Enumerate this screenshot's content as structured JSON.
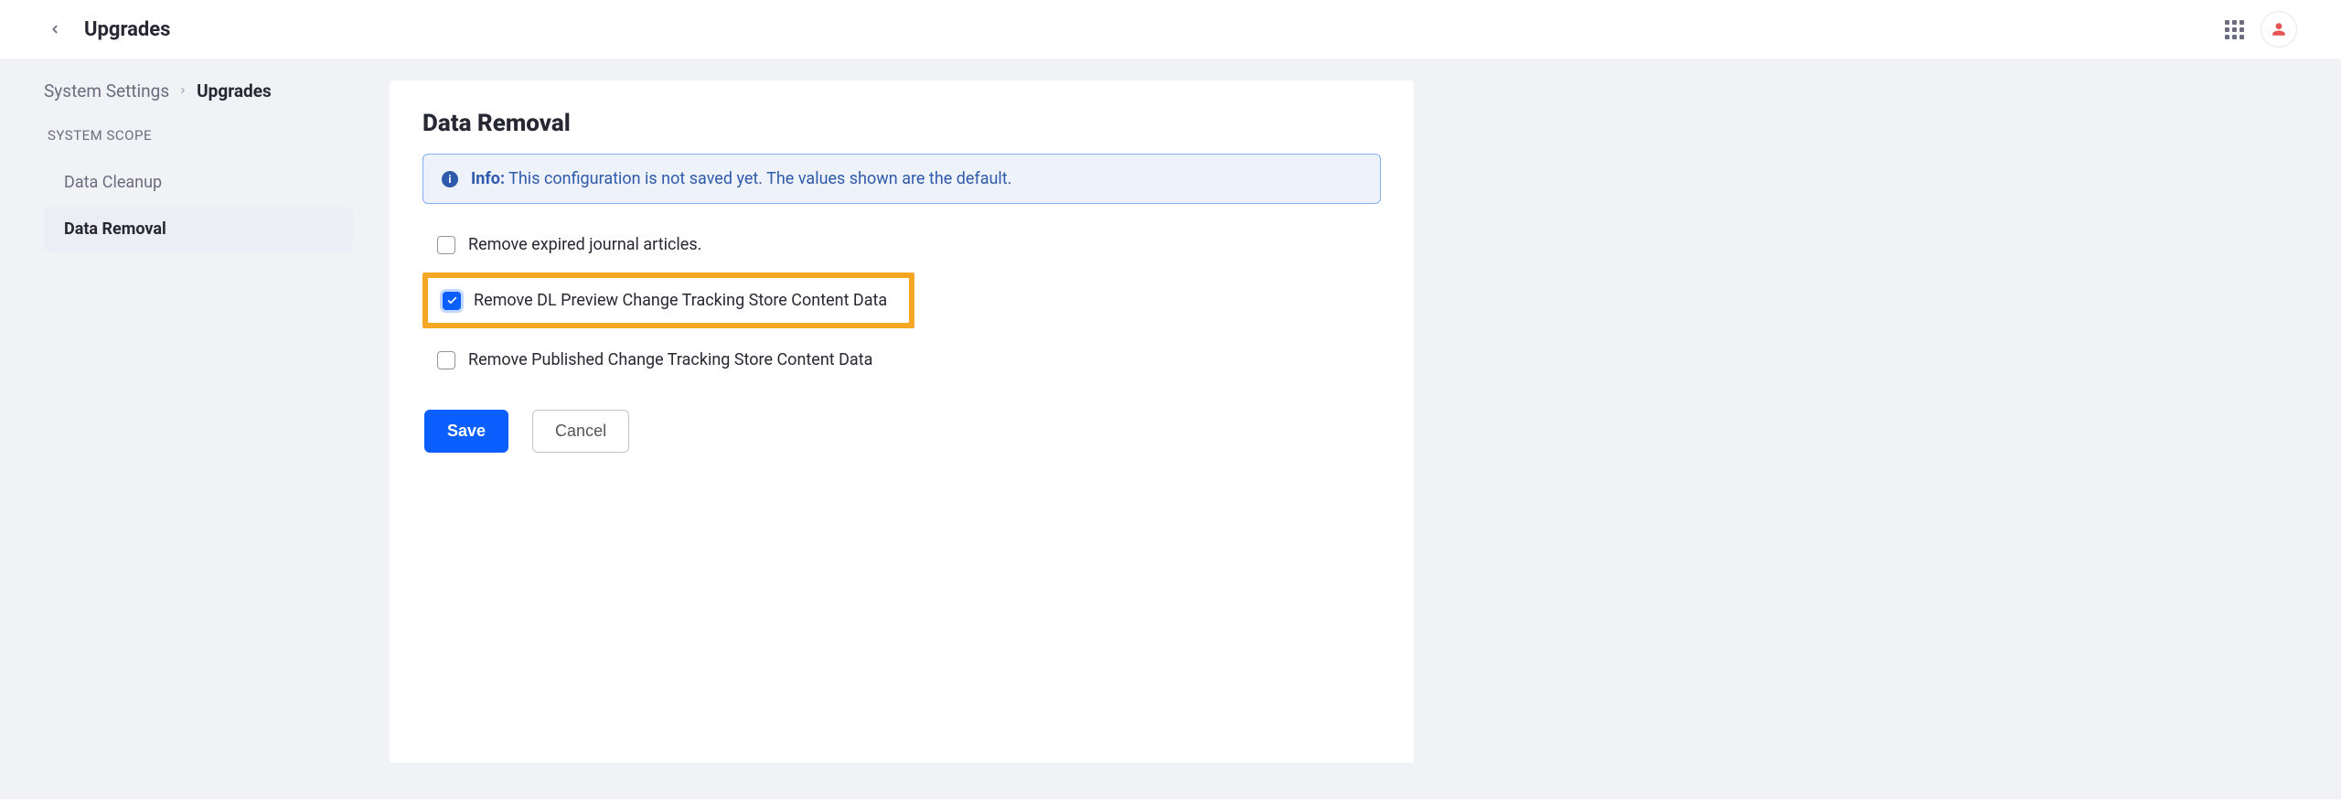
{
  "topbar": {
    "title": "Upgrades"
  },
  "breadcrumb": {
    "root": "System Settings",
    "current": "Upgrades"
  },
  "sidebar": {
    "scope_label": "SYSTEM SCOPE",
    "items": [
      {
        "label": "Data Cleanup",
        "active": false
      },
      {
        "label": "Data Removal",
        "active": true
      }
    ]
  },
  "panel": {
    "title": "Data Removal",
    "info_label": "Info:",
    "info_text": "This configuration is not saved yet. The values shown are the default.",
    "checkboxes": [
      {
        "label": "Remove expired journal articles.",
        "checked": false,
        "highlight": false
      },
      {
        "label": "Remove DL Preview Change Tracking Store Content Data",
        "checked": true,
        "highlight": true
      },
      {
        "label": "Remove Published Change Tracking Store Content Data",
        "checked": false,
        "highlight": false
      }
    ],
    "save_label": "Save",
    "cancel_label": "Cancel"
  }
}
